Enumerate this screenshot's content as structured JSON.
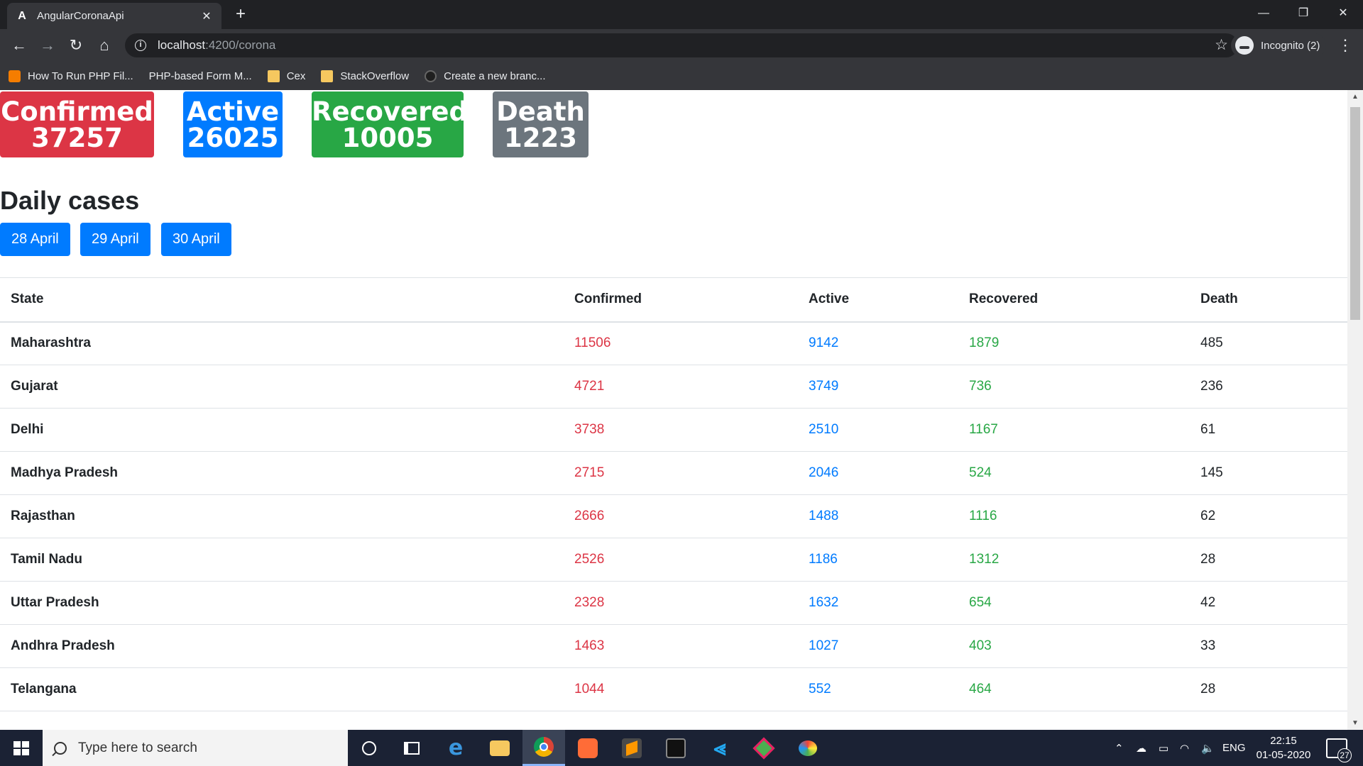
{
  "browser": {
    "tab_title": "AngularCoronaApi",
    "tab_favicon": "A",
    "tab_close": "✕",
    "new_tab": "+",
    "url_host": "localhost",
    "url_path": ":4200/corona",
    "incognito_label": "Incognito (2)",
    "bookmarks": [
      {
        "label": "How To Run PHP Fil...",
        "icon": "blogger-icon"
      },
      {
        "label": "PHP-based Form M...",
        "icon": "page-icon"
      },
      {
        "label": "Cex",
        "icon": "folder-icon"
      },
      {
        "label": "StackOverflow",
        "icon": "folder-icon"
      },
      {
        "label": "Create a new branc...",
        "icon": "github-icon"
      }
    ]
  },
  "stats": {
    "confirmed": {
      "label": "Confirmed",
      "value": "37257",
      "color": "#dc3545"
    },
    "active": {
      "label": "Active",
      "value": "26025",
      "color": "#007bff"
    },
    "recovered": {
      "label": "Recovered",
      "value": "10005",
      "color": "#28a745"
    },
    "death": {
      "label": "Death",
      "value": "1223",
      "color": "#6c757d"
    }
  },
  "daily": {
    "title": "Daily cases",
    "dates": [
      "28 April",
      "29 April",
      "30 April"
    ]
  },
  "table": {
    "headers": [
      "State",
      "Confirmed",
      "Active",
      "Recovered",
      "Death"
    ],
    "rows": [
      [
        "Maharashtra",
        "11506",
        "9142",
        "1879",
        "485"
      ],
      [
        "Gujarat",
        "4721",
        "3749",
        "736",
        "236"
      ],
      [
        "Delhi",
        "3738",
        "2510",
        "1167",
        "61"
      ],
      [
        "Madhya Pradesh",
        "2715",
        "2046",
        "524",
        "145"
      ],
      [
        "Rajasthan",
        "2666",
        "1488",
        "1116",
        "62"
      ],
      [
        "Tamil Nadu",
        "2526",
        "1186",
        "1312",
        "28"
      ],
      [
        "Uttar Pradesh",
        "2328",
        "1632",
        "654",
        "42"
      ],
      [
        "Andhra Pradesh",
        "1463",
        "1027",
        "403",
        "33"
      ],
      [
        "Telangana",
        "1044",
        "552",
        "464",
        "28"
      ]
    ]
  },
  "taskbar": {
    "search_placeholder": "Type here to search",
    "language": "ENG",
    "time": "22:15",
    "date": "01-05-2020",
    "notification_count": "27"
  }
}
